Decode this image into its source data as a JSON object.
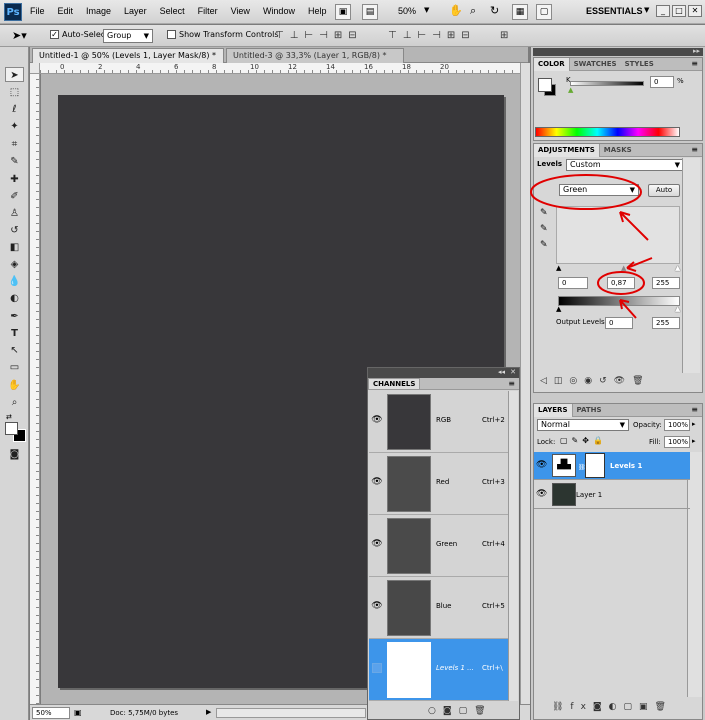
{
  "app": {
    "logo": "Ps"
  },
  "menu": [
    "File",
    "Edit",
    "Image",
    "Layer",
    "Select",
    "Filter",
    "View",
    "Window",
    "Help"
  ],
  "menubar": {
    "zoom": "50%",
    "workspace": "ESSENTIALS"
  },
  "options": {
    "auto_select_label": "Auto-Select:",
    "auto_select_value": "Group",
    "show_transform_label": "Show Transform Controls"
  },
  "tabs": [
    {
      "label": "Untitled-1 @ 50% (Levels 1, Layer Mask/8) *"
    },
    {
      "label": "Untitled-3 @ 33,3% (Layer 1, RGB/8) *"
    }
  ],
  "ruler": {
    "top_numbers": [
      "0",
      "2",
      "4",
      "6",
      "8",
      "10",
      "12",
      "14",
      "16",
      "18",
      "20"
    ]
  },
  "status": {
    "zoom": "50%",
    "doc": "Doc: 5,75M/0 bytes"
  },
  "channels": {
    "title": "CHANNELS",
    "rows": [
      {
        "name": "RGB",
        "key": "Ctrl+2",
        "thumb": "#38373a"
      },
      {
        "name": "Red",
        "key": "Ctrl+3",
        "thumb": "#4b4b4b"
      },
      {
        "name": "Green",
        "key": "Ctrl+4",
        "thumb": "#4a4a4a"
      },
      {
        "name": "Blue",
        "key": "Ctrl+5",
        "thumb": "#484848"
      },
      {
        "name": "Levels 1 ...",
        "key": "Ctrl+\\",
        "thumb": "#ffffff"
      }
    ]
  },
  "color_panel": {
    "tabs": [
      "COLOR",
      "SWATCHES",
      "STYLES"
    ],
    "channel": "K",
    "value": "0",
    "unit": "%"
  },
  "adjustments": {
    "tabs": [
      "ADJUSTMENTS",
      "MASKS"
    ],
    "title": "Levels",
    "preset": "Custom",
    "channel": "Green",
    "auto_label": "Auto",
    "input_black": "0",
    "input_gamma": "0,87",
    "input_white": "255",
    "output_label": "Output Levels:",
    "output_black": "0",
    "output_white": "255"
  },
  "layers": {
    "tabs": [
      "LAYERS",
      "PATHS"
    ],
    "blend_mode": "Normal",
    "opacity_label": "Opacity:",
    "opacity": "100%",
    "lock_label": "Lock:",
    "fill_label": "Fill:",
    "fill": "100%",
    "items": [
      {
        "name": "Levels 1"
      },
      {
        "name": "Layer 1"
      }
    ]
  },
  "colors": {
    "selection": "#3d95ea",
    "canvas": "#38373a",
    "annotation": "#e00000"
  }
}
